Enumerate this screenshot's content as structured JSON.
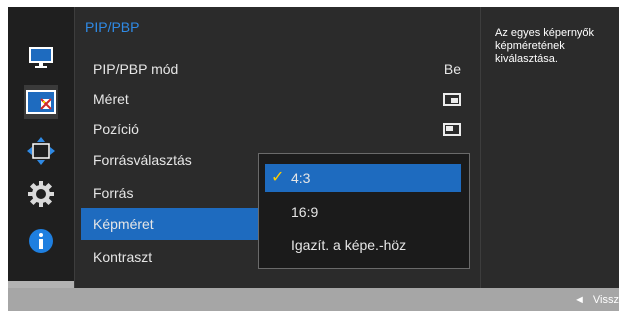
{
  "menu": {
    "title": "PIP/PBP",
    "items": [
      {
        "label": "PIP/PBP mód",
        "value": "Be"
      },
      {
        "label": "Méret"
      },
      {
        "label": "Pozíció"
      },
      {
        "label": "Forrásválasztás"
      },
      {
        "label": "Forrás"
      },
      {
        "label": "Képméret"
      },
      {
        "label": "Kontraszt"
      }
    ]
  },
  "dropdown": {
    "options": [
      "4:3",
      "16:9",
      "Igazít. a képe.-höz"
    ],
    "selected": "4:3"
  },
  "help": {
    "text": "Az egyes képernyők képméretének kiválasztása."
  },
  "bottom": {
    "back_label": "Vissz"
  },
  "colors": {
    "accent": "#1e6bbf",
    "title": "#2f8ae5",
    "check": "#ffcf00"
  },
  "nav_icons": [
    "monitor-icon",
    "picture-icon",
    "position-arrows-icon",
    "settings-gear-icon",
    "info-icon"
  ]
}
